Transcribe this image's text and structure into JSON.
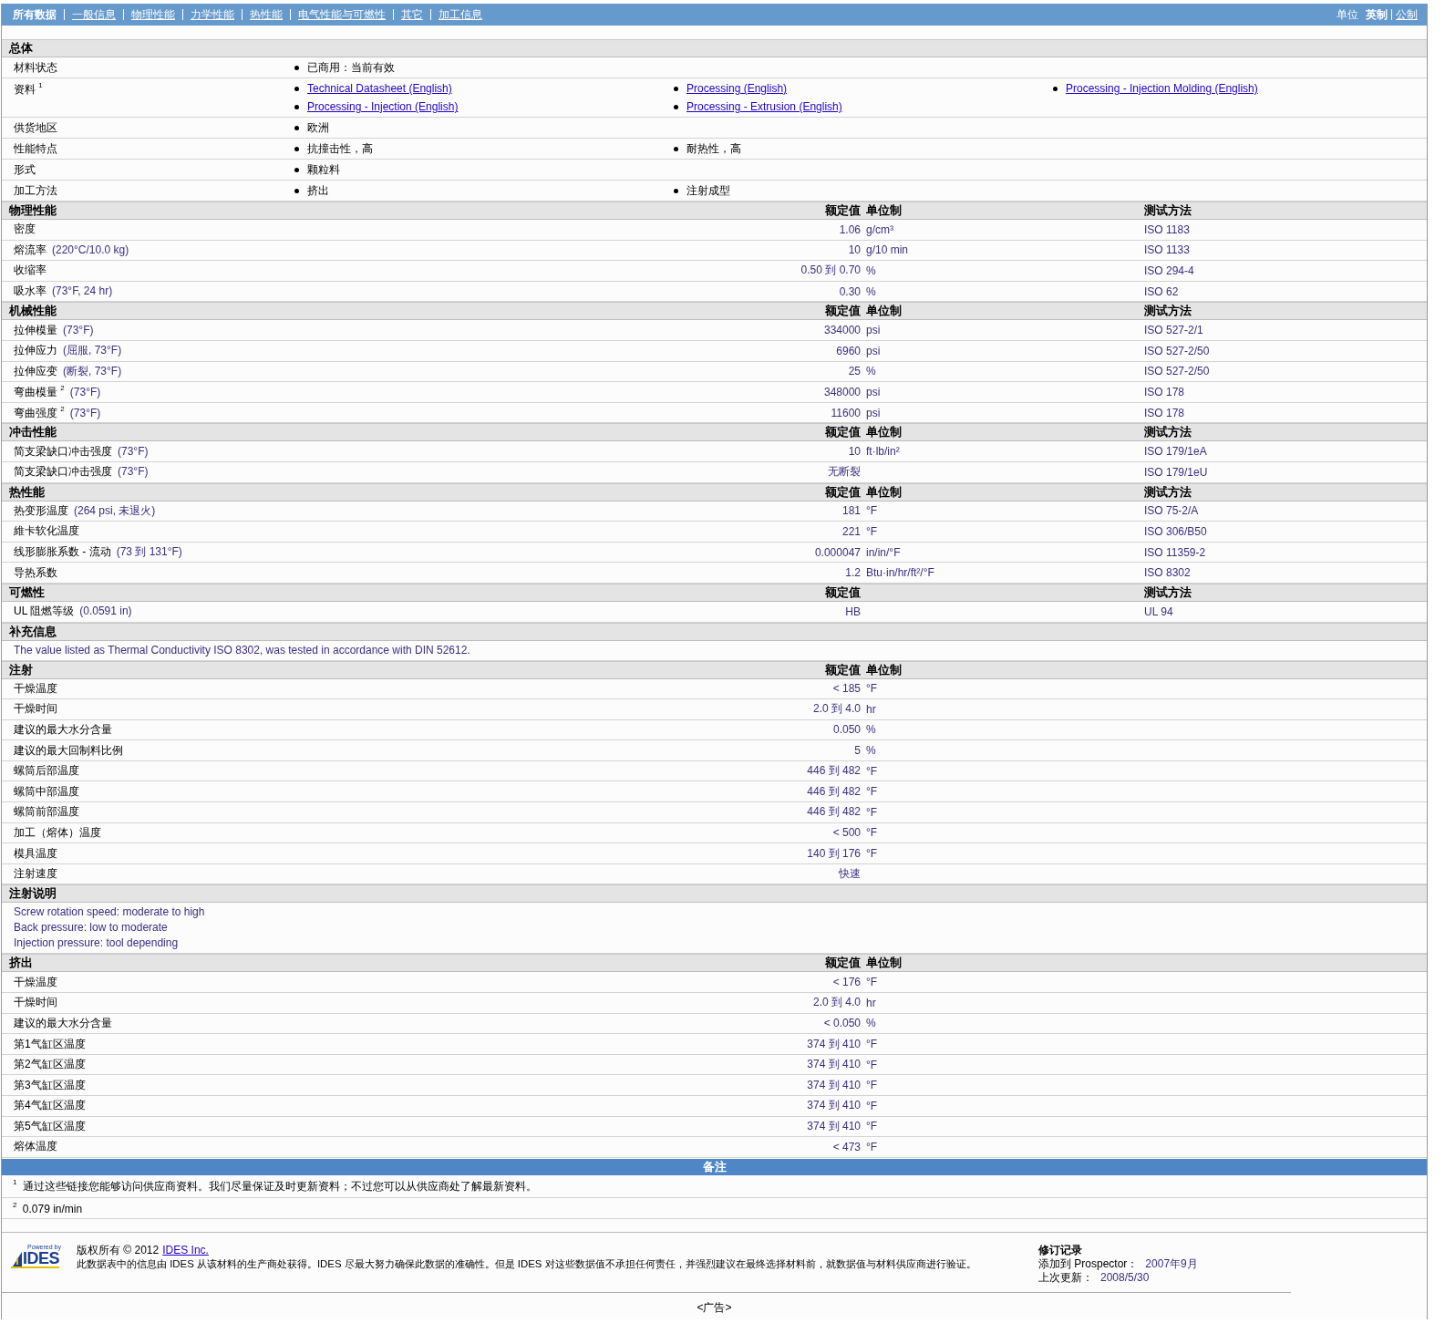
{
  "nav": {
    "tabs": [
      {
        "label": "所有数据",
        "selected": true
      },
      {
        "label": "一般信息",
        "selected": false
      },
      {
        "label": "物理性能",
        "selected": false
      },
      {
        "label": "力学性能",
        "selected": false
      },
      {
        "label": "热性能",
        "selected": false
      },
      {
        "label": "电气性能与可燃性",
        "selected": false
      },
      {
        "label": "其它",
        "selected": false
      },
      {
        "label": "加工信息",
        "selected": false
      }
    ],
    "units_label": "单位",
    "units": [
      {
        "label": "英制",
        "selected": true
      },
      {
        "label": "公制",
        "selected": false
      }
    ]
  },
  "sections": [
    {
      "kind": "general",
      "title": "总体",
      "rows": [
        {
          "label": "材料状态",
          "items": [
            {
              "text": "已商用：当前有效",
              "link": false
            }
          ]
        },
        {
          "label": "资料 $^{1}$",
          "items": [
            {
              "text": "Technical Datasheet (English)",
              "link": true
            },
            {
              "text": "Processing (English)",
              "link": true
            },
            {
              "text": "Processing - Injection Molding (English)",
              "link": true
            },
            {
              "text": "Processing - Injection (English)",
              "link": true
            },
            {
              "text": "Processing - Extrusion (English)",
              "link": true
            }
          ]
        },
        {
          "label": "供货地区",
          "items": [
            {
              "text": "欧洲",
              "link": false
            }
          ]
        },
        {
          "label": "性能特点",
          "items": [
            {
              "text": "抗撞击性，高",
              "link": false
            },
            {
              "text": "耐热性，高",
              "link": false
            }
          ]
        },
        {
          "label": "形式",
          "items": [
            {
              "text": "颗粒料",
              "link": false
            }
          ]
        },
        {
          "label": "加工方法",
          "items": [
            {
              "text": "挤出",
              "link": false
            },
            {
              "text": "注射成型",
              "link": false
            }
          ]
        }
      ]
    },
    {
      "kind": "properties",
      "title": "物理性能",
      "header": {
        "value": "额定值",
        "unit": "单位制",
        "method": "测试方法"
      },
      "rows": [
        {
          "name": "密度",
          "value": "1.06",
          "unit": "g/cm³",
          "method": "ISO 1183"
        },
        {
          "name": "熔流率",
          "condition": "(220°C/10.0 kg)",
          "value": "10",
          "unit": "g/10 min",
          "method": "ISO 1133"
        },
        {
          "name": "收缩率",
          "value": "0.50 到 0.70",
          "unit": "%",
          "method": "ISO 294-4"
        },
        {
          "name": "吸水率",
          "condition": "(73°F, 24 hr)",
          "value": "0.30",
          "unit": "%",
          "method": "ISO 62"
        }
      ]
    },
    {
      "kind": "properties",
      "title": "机械性能",
      "header": {
        "value": "额定值",
        "unit": "单位制",
        "method": "测试方法"
      },
      "rows": [
        {
          "name": "拉伸模量",
          "condition": "(73°F)",
          "value": "334000",
          "unit": "psi",
          "method": "ISO 527-2/1"
        },
        {
          "name": "拉伸应力",
          "condition": "(屈服, 73°F)",
          "value": "6960",
          "unit": "psi",
          "method": "ISO 527-2/50"
        },
        {
          "name": "拉伸应变",
          "condition": "(断裂, 73°F)",
          "value": "25",
          "unit": "%",
          "method": "ISO 527-2/50"
        },
        {
          "name": "弯曲模量 $^{2}$",
          "condition": "(73°F)",
          "value": "348000",
          "unit": "psi",
          "method": "ISO 178"
        },
        {
          "name": "弯曲强度 $^{2}$",
          "condition": "(73°F)",
          "value": "11600",
          "unit": "psi",
          "method": "ISO 178"
        }
      ]
    },
    {
      "kind": "properties",
      "title": "冲击性能",
      "header": {
        "value": "额定值",
        "unit": "单位制",
        "method": "测试方法"
      },
      "rows": [
        {
          "name": "简支梁缺口冲击强度",
          "condition": "(73°F)",
          "value": "10",
          "unit": "ft·lb/in²",
          "method": "ISO 179/1eA"
        },
        {
          "name": "简支梁缺口冲击强度",
          "condition": "(73°F)",
          "value": "无断裂",
          "method": "ISO 179/1eU"
        }
      ]
    },
    {
      "kind": "properties",
      "title": "热性能",
      "header": {
        "value": "额定值",
        "unit": "单位制",
        "method": "测试方法"
      },
      "rows": [
        {
          "name": "热变形温度",
          "condition": "(264 psi, 未退火)",
          "value": "181",
          "unit": "°F",
          "method": "ISO 75-2/A"
        },
        {
          "name": "維卡软化温度",
          "value": "221",
          "unit": "°F",
          "method": "ISO 306/B50"
        },
        {
          "name": "线形膨胀系数 - 流动",
          "condition": "(73 到 131°F)",
          "value": "0.000047",
          "unit": "in/in/°F",
          "method": "ISO 11359-2"
        },
        {
          "name": "导热系数",
          "value": "1.2",
          "unit": "Btu·in/hr/ft²/°F",
          "method": "ISO 8302"
        }
      ]
    },
    {
      "kind": "properties",
      "title": "可燃性",
      "header": {
        "value": "额定值",
        "method": "测试方法"
      },
      "rows": [
        {
          "name": "UL 阻燃等级",
          "condition": "(0.0591 in)",
          "value": "HB",
          "method": "UL 94"
        }
      ]
    },
    {
      "kind": "text",
      "title": "补充信息",
      "lines": [
        "The value listed as Thermal Conductivity ISO 8302, was tested in accordance with DIN 52612."
      ]
    },
    {
      "kind": "properties",
      "title": "注射",
      "header": {
        "value": "额定值",
        "unit": "单位制"
      },
      "rows": [
        {
          "name": "干燥温度",
          "value": "< 185",
          "unit": "°F"
        },
        {
          "name": "干燥时间",
          "value": "2.0 到 4.0",
          "unit": "hr"
        },
        {
          "name": "建议的最大水分含量",
          "value": "0.050",
          "unit": "%"
        },
        {
          "name": "建议的最大回制料比例",
          "value": "5",
          "unit": "%"
        },
        {
          "name": "螺筒后部温度",
          "value": "446 到 482",
          "unit": "°F"
        },
        {
          "name": "螺筒中部温度",
          "value": "446 到 482",
          "unit": "°F"
        },
        {
          "name": "螺筒前部温度",
          "value": "446 到 482",
          "unit": "°F"
        },
        {
          "name": "加工（熔体）温度",
          "value": "< 500",
          "unit": "°F"
        },
        {
          "name": "模具温度",
          "value": "140 到 176",
          "unit": "°F"
        },
        {
          "name": "注射速度",
          "value": "快速"
        }
      ]
    },
    {
      "kind": "text",
      "title": "注射说明",
      "lines": [
        "Screw rotation speed: moderate to high",
        "Back pressure: low to moderate",
        "Injection pressure: tool depending"
      ]
    },
    {
      "kind": "properties",
      "title": "挤出",
      "header": {
        "value": "额定值",
        "unit": "单位制"
      },
      "rows": [
        {
          "name": "干燥温度",
          "value": "< 176",
          "unit": "°F"
        },
        {
          "name": "干燥时间",
          "value": "2.0 到 4.0",
          "unit": "hr"
        },
        {
          "name": "建议的最大水分含量",
          "value": "< 0.050",
          "unit": "%"
        },
        {
          "name": "第1气缸区温度",
          "value": "374 到 410",
          "unit": "°F"
        },
        {
          "name": "第2气缸区温度",
          "value": "374 到 410",
          "unit": "°F"
        },
        {
          "name": "第3气缸区温度",
          "value": "374 到 410",
          "unit": "°F"
        },
        {
          "name": "第4气缸区温度",
          "value": "374 到 410",
          "unit": "°F"
        },
        {
          "name": "第5气缸区温度",
          "value": "374 到 410",
          "unit": "°F"
        },
        {
          "name": "熔体温度",
          "value": "< 473",
          "unit": "°F"
        }
      ]
    }
  ],
  "notes": {
    "title": "备注",
    "items": [
      "$^{1}$ 通过这些链接您能够访问供应商资料。我们尽量保证及时更新资料；不过您可以从供应商处了解最新资料。",
      "$^{2}$ 0.079 in/min"
    ]
  },
  "footer": {
    "logo_small": "Powered by",
    "logo": "IDES",
    "copyright": "版权所有 © 2012",
    "copyright_link": "IDES Inc.",
    "disclaimer": "此数据表中的信息由 IDES 从该材料的生产商处获得。IDES 尽最大努力确保此数据的准确性。但是 IDES 对这些数据值不承担任何责任，并强烈建议在最终选择材料前，就数据值与材料供应商进行验证。",
    "revision_title": "修订记录",
    "added_label": "添加到 Prospector：",
    "added_value": "2007年9月",
    "updated_label": "上次更新：",
    "updated_value": "2008/5/30",
    "ad": "<广告>"
  }
}
